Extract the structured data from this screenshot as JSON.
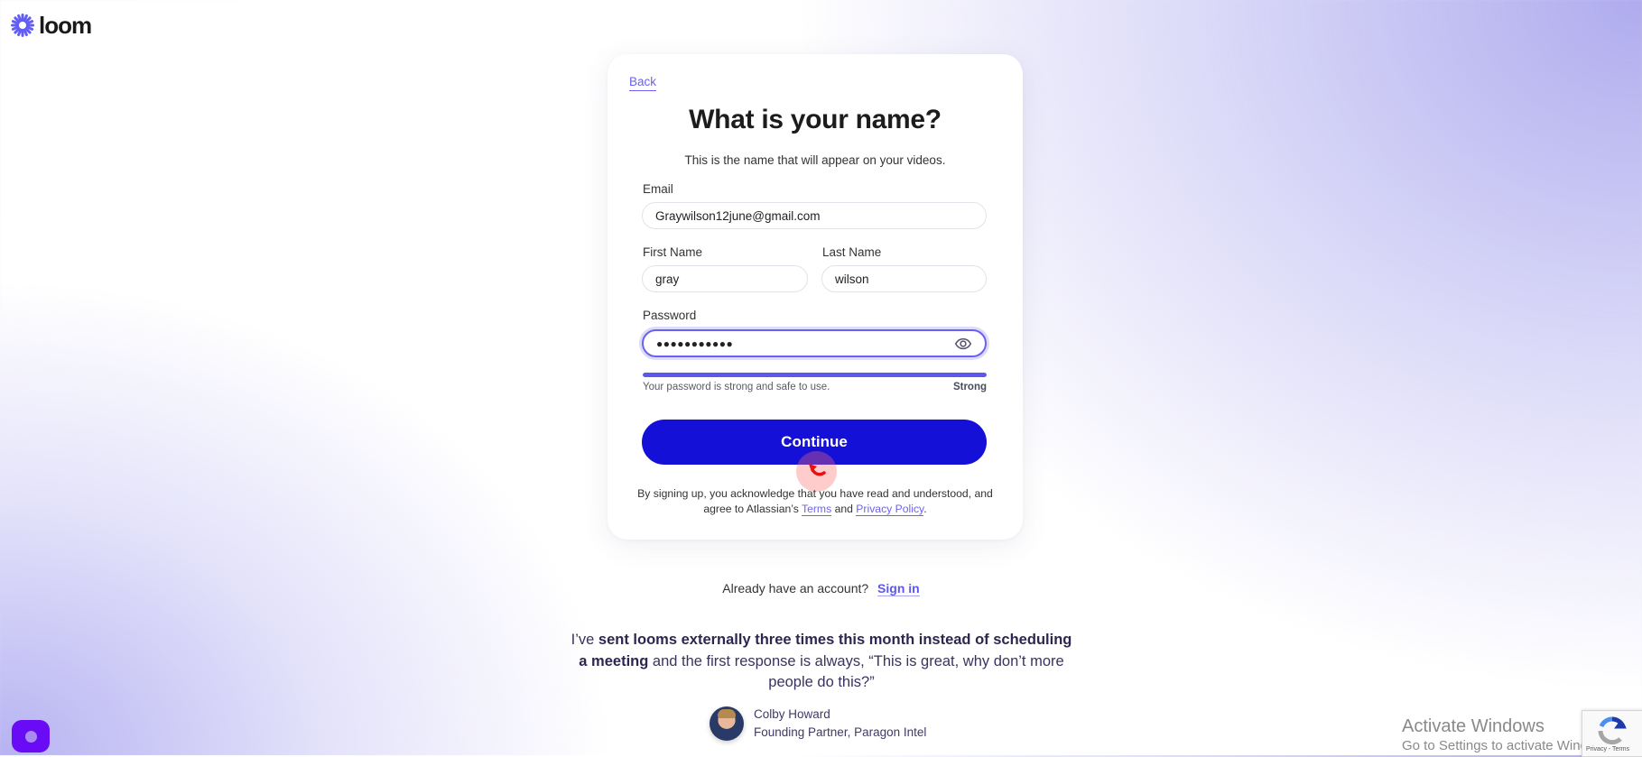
{
  "app": {
    "logo_text": "loom",
    "logo_icon": "loom-starburst-icon"
  },
  "colors": {
    "brand": "#625df5",
    "primary_button": "#1410d8",
    "link": "#6d63ee"
  },
  "card": {
    "back_label": "Back",
    "title": "What is your name?",
    "subtitle": "This is the name that will appear on your videos.",
    "email": {
      "label": "Email",
      "value": "Graywilson12june@gmail.com"
    },
    "first_name": {
      "label": "First Name",
      "value": "gray"
    },
    "last_name": {
      "label": "Last Name",
      "value": "wilson"
    },
    "password": {
      "label": "Password",
      "value": "●●●●●●●●●●●",
      "toggle_icon": "eye-icon"
    },
    "strength": {
      "percent": 100,
      "helper": "Your password is strong and safe to use.",
      "label": "Strong"
    },
    "continue_label": "Continue",
    "legal": {
      "prefix": "By signing up, you acknowledge that you have read and understood, and agree to Atlassian’s ",
      "terms": "Terms",
      "and": " and ",
      "privacy": "Privacy Policy",
      "suffix": "."
    }
  },
  "signin": {
    "prompt": "Already have an account?",
    "link": "Sign in"
  },
  "testimonial": {
    "lead": "I’ve ",
    "bold": "sent looms externally three times this month instead of scheduling a meeting",
    "rest": " and the first response is always, “This is great, why don’t more people do this?”",
    "author_name": "Colby Howard",
    "author_title": "Founding Partner, Paragon Intel"
  },
  "os_overlay": {
    "activate_title": "Activate Windows",
    "activate_sub": "Go to Settings to activate Windows.",
    "recaptcha_links": "Privacy - Terms"
  }
}
